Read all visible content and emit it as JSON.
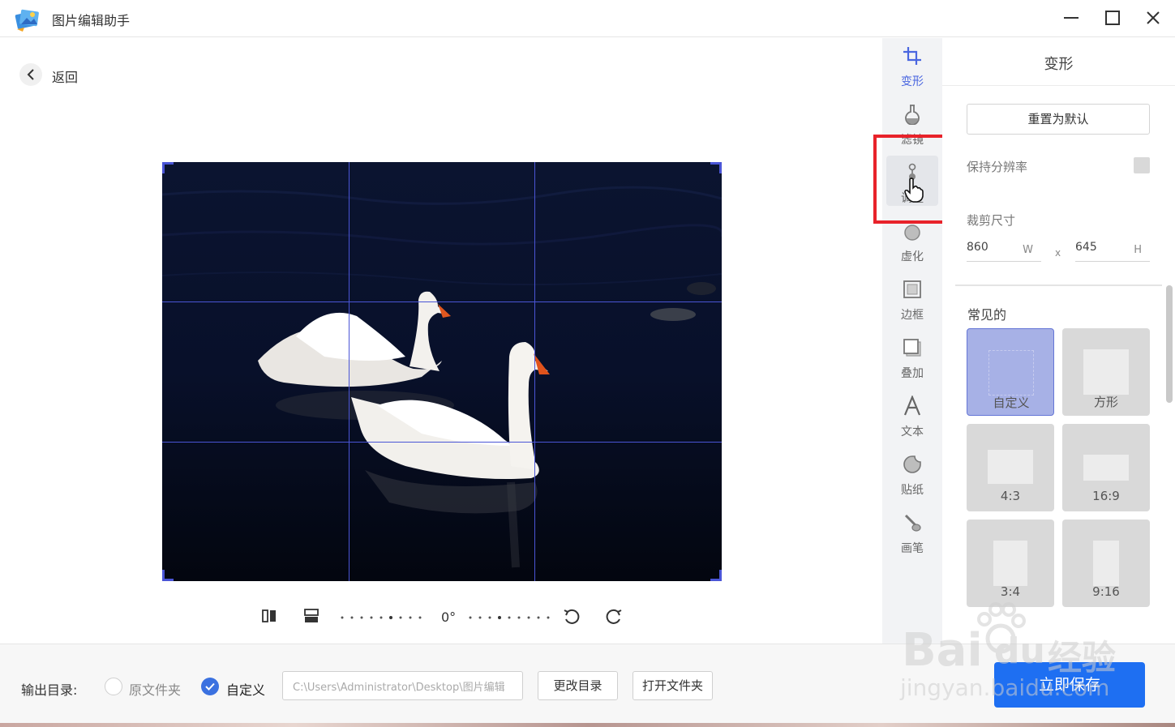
{
  "titlebar": {
    "title": "图片编辑助手"
  },
  "nav": {
    "back_label": "返回"
  },
  "editor": {
    "angle": "0°"
  },
  "tools": [
    {
      "label": "变形",
      "icon": "crop-icon"
    },
    {
      "label": "滤镜",
      "icon": "filter-flask-icon"
    },
    {
      "label": "调整",
      "icon": "adjust-slider-icon"
    },
    {
      "label": "虚化",
      "icon": "blur-drop-icon"
    },
    {
      "label": "边框",
      "icon": "border-frame-icon"
    },
    {
      "label": "叠加",
      "icon": "overlay-layers-icon"
    },
    {
      "label": "文本",
      "icon": "text-a-icon"
    },
    {
      "label": "贴纸",
      "icon": "sticker-icon"
    },
    {
      "label": "画笔",
      "icon": "brush-icon"
    }
  ],
  "panel": {
    "title": "变形",
    "reset_label": "重置为默认",
    "keep_resolution_label": "保持分辨率",
    "crop_size_label": "裁剪尺寸",
    "width_value": "860",
    "width_unit": "W",
    "times_sign": "x",
    "height_value": "645",
    "height_unit": "H",
    "common_label": "常见的",
    "ratios": [
      {
        "label": "自定义",
        "selected": true
      },
      {
        "label": "方形",
        "selected": false
      },
      {
        "label": "4:3",
        "selected": false
      },
      {
        "label": "16:9",
        "selected": false
      },
      {
        "label": "3:4",
        "selected": false
      },
      {
        "label": "9:16",
        "selected": false
      }
    ]
  },
  "bottom": {
    "output_label": "输出目录:",
    "option_original": "原文件夹",
    "option_custom": "自定义",
    "path_value": "C:\\Users\\Administrator\\Desktop\\图片编辑",
    "change_dir_label": "更改目录",
    "open_folder_label": "打开文件夹",
    "save_label": "立即保存"
  },
  "watermark": {
    "line1": "Bai",
    "line2": "du",
    "line3": "经验",
    "line4": "jingyan.baidu.com"
  },
  "colors": {
    "accent": "#4a66e0",
    "primary_button": "#1e6ff2",
    "highlight": "#e8222a",
    "grid": "#4a55d6"
  }
}
